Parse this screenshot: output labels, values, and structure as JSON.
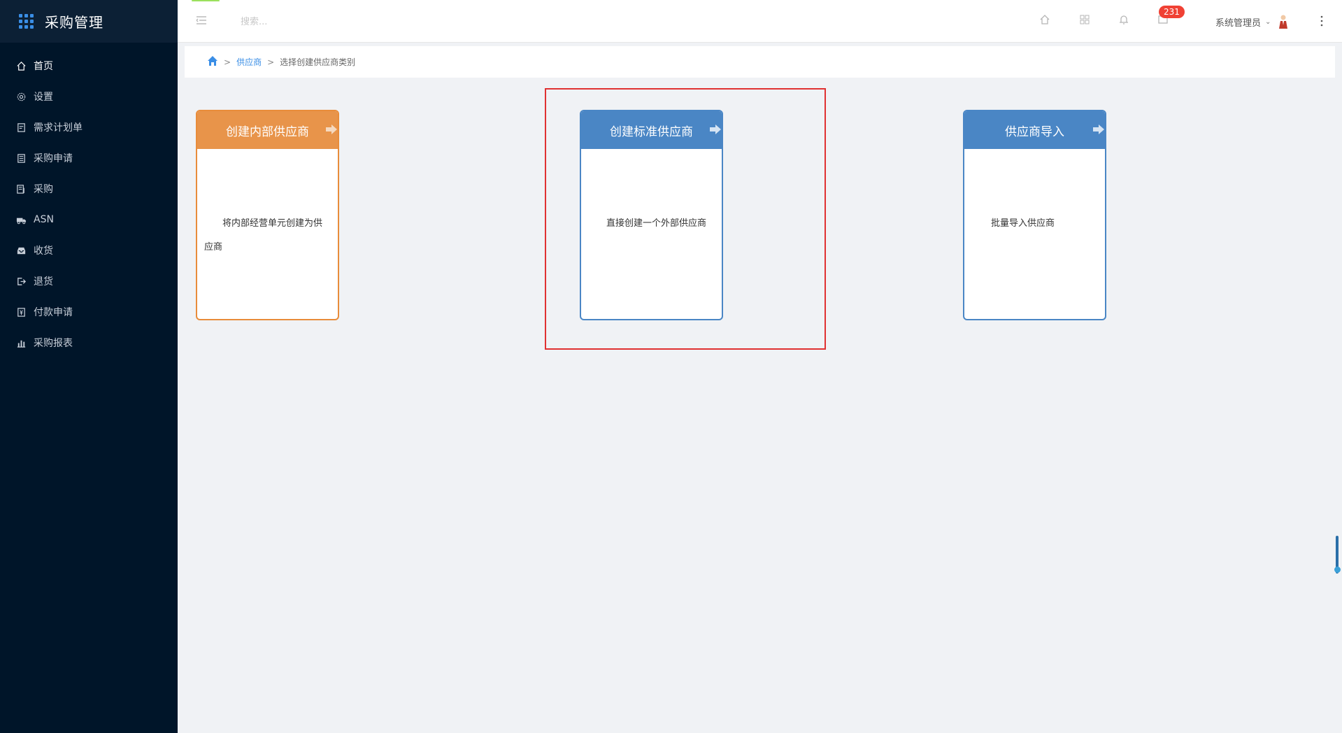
{
  "app": {
    "title": "采购管理"
  },
  "sidebar": {
    "items": [
      {
        "label": "首页",
        "icon": "home-icon",
        "active": true
      },
      {
        "label": "设置",
        "icon": "gear-icon"
      },
      {
        "label": "需求计划单",
        "icon": "document-icon"
      },
      {
        "label": "采购申请",
        "icon": "form-icon"
      },
      {
        "label": "采购",
        "icon": "list-icon"
      },
      {
        "label": "ASN",
        "icon": "truck-icon"
      },
      {
        "label": "收货",
        "icon": "inbox-icon"
      },
      {
        "label": "退货",
        "icon": "exit-icon"
      },
      {
        "label": "付款申请",
        "icon": "payment-icon"
      },
      {
        "label": "采购报表",
        "icon": "chart-icon"
      }
    ]
  },
  "header": {
    "search_placeholder": "搜索...",
    "notification_count": "231",
    "user_name": "系统管理员"
  },
  "breadcrumb": {
    "parent": "供应商",
    "current": "选择创建供应商类别",
    "separator": ">"
  },
  "cards": [
    {
      "title": "创建内部供应商",
      "desc": "将内部经营单元创建为供应商",
      "color": "#e8944a"
    },
    {
      "title": "创建标准供应商",
      "desc": "直接创建一个外部供应商",
      "color": "#4a86c5"
    },
    {
      "title": "供应商导入",
      "desc": "批量导入供应商",
      "color": "#4a86c5"
    }
  ]
}
